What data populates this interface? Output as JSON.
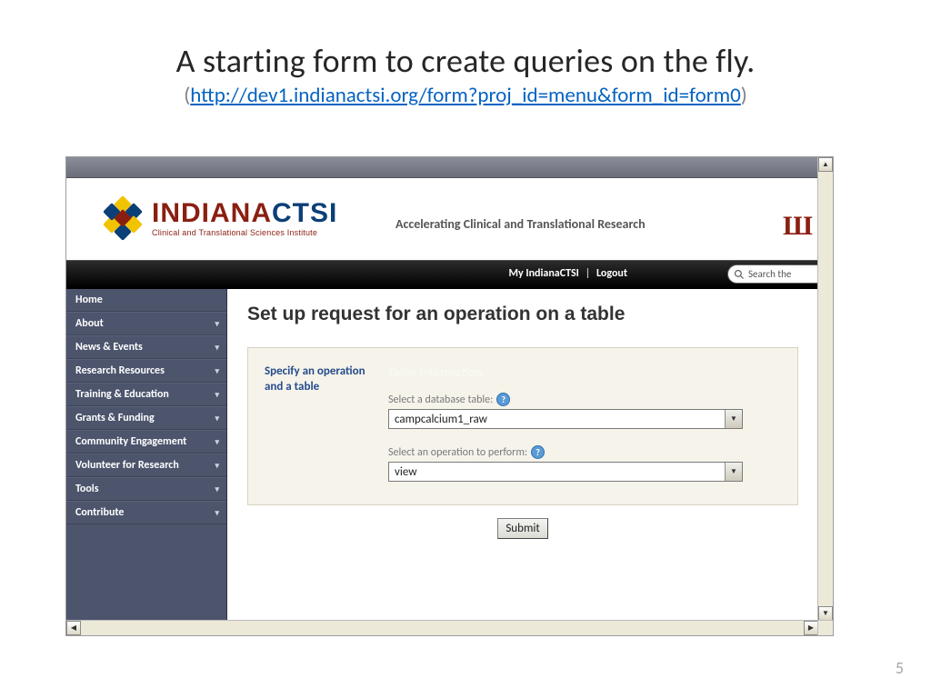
{
  "slide": {
    "title": "A starting form to create queries on the fly.",
    "url": "http://dev1.indianactsi.org/form?proj_id=menu&form_id=form0",
    "page_number": "5"
  },
  "header": {
    "brand_a": "INDIANA",
    "brand_b": "CTSI",
    "brand_sub": "Clinical and Translational Sciences Institute",
    "tagline": "Accelerating Clinical and Translational Research",
    "iu_mark": "Ш"
  },
  "topnav": {
    "link1": "My IndianaCTSI",
    "sep": "|",
    "link2": "Logout",
    "search_placeholder": "Search the"
  },
  "sidebar": {
    "items": [
      {
        "label": "Home",
        "has_sub": false
      },
      {
        "label": "About",
        "has_sub": true
      },
      {
        "label": "News & Events",
        "has_sub": true
      },
      {
        "label": "Research Resources",
        "has_sub": true
      },
      {
        "label": "Training & Education",
        "has_sub": true
      },
      {
        "label": "Grants & Funding",
        "has_sub": true
      },
      {
        "label": "Community Engagement",
        "has_sub": true
      },
      {
        "label": "Volunteer for Research",
        "has_sub": true
      },
      {
        "label": "Tools",
        "has_sub": true
      },
      {
        "label": "Contribute",
        "has_sub": true
      }
    ]
  },
  "form": {
    "heading": "Set up request for an operation on a table",
    "step_label": "Specify an operation and a table",
    "section_title": "Table Information",
    "field_table_label": "Select a database table:",
    "field_table_value": "campcalcium1_raw",
    "field_op_label": "Select an operation to perform:",
    "field_op_value": "view",
    "submit_label": "Submit"
  }
}
